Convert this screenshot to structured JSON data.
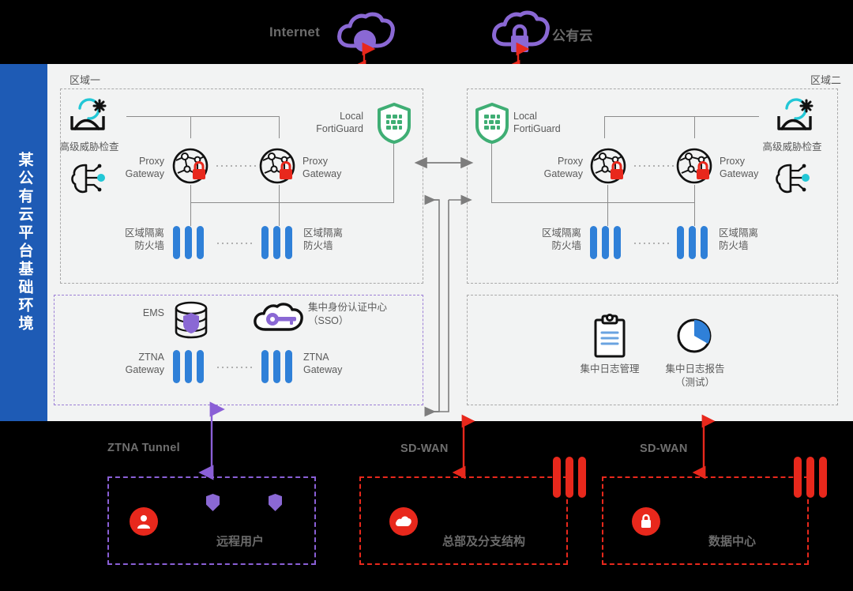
{
  "clouds": [
    {
      "id": "internet",
      "label": "Internet",
      "icon": "cloud-node-icon"
    },
    {
      "id": "public-cloud",
      "label": "公有云",
      "icon": "cloud-lock-icon"
    }
  ],
  "sidebar": {
    "title": "某公有云平台基础环境",
    "color": "#1e5bb5"
  },
  "zones": [
    {
      "id": "zone-one",
      "title": "区域一",
      "threat_inspection": {
        "label": "高级威胁检查",
        "icon": "threat-sandbox-icon"
      },
      "ai_icon": "ai-brain-icon",
      "fortiguard": {
        "label": "Local\nFortiGuard",
        "icon": "shield-grid-icon",
        "color": "#3fae74"
      },
      "proxy_gateways": [
        {
          "label": "Proxy\nGateway",
          "icon": "globe-lock-icon"
        },
        {
          "label": "Proxy\nGateway",
          "icon": "globe-lock-icon"
        }
      ],
      "firewalls": [
        {
          "label": "区域隔离\n防火墙",
          "icon": "firewall-bars-icon"
        },
        {
          "label": "区域隔离\n防火墙",
          "icon": "firewall-bars-icon"
        }
      ]
    },
    {
      "id": "zone-two",
      "title": "区域二",
      "threat_inspection": {
        "label": "高级威胁检查",
        "icon": "threat-sandbox-icon"
      },
      "ai_icon": "ai-brain-icon",
      "fortiguard": {
        "label": "Local\nFortiGuard",
        "icon": "shield-grid-icon",
        "color": "#3fae74"
      },
      "proxy_gateways": [
        {
          "label": "Proxy\nGateway",
          "icon": "globe-lock-icon"
        },
        {
          "label": "Proxy\nGateway",
          "icon": "globe-lock-icon"
        }
      ],
      "firewalls": [
        {
          "label": "区域隔离\n防火墙",
          "icon": "firewall-bars-icon"
        },
        {
          "label": "区域隔离\n防火墙",
          "icon": "firewall-bars-icon"
        }
      ]
    }
  ],
  "services_left": {
    "id": "identity-zone",
    "border_color": "#9c7fd6",
    "ems": {
      "label": "EMS",
      "icon": "database-shield-icon"
    },
    "sso": {
      "label": "集中身份认证中心\n（SSO）",
      "icon": "cloud-key-icon"
    },
    "ztna_gateways": [
      {
        "label": "ZTNA\nGateway",
        "icon": "firewall-bars-icon"
      },
      {
        "label": "ZTNA\nGateway",
        "icon": "firewall-bars-icon"
      }
    ]
  },
  "services_right": {
    "id": "logging-zone",
    "items": [
      {
        "label": "集中日志管理",
        "icon": "clipboard-log-icon"
      },
      {
        "label": "集中日志报告\n（测试）",
        "icon": "pie-chart-icon"
      }
    ]
  },
  "bottom": {
    "links": [
      {
        "label": "ZTNA Tunnel",
        "color": "#8a5fd6"
      },
      {
        "label": "SD-WAN",
        "color": "#e8281c"
      },
      {
        "label": "SD-WAN",
        "color": "#e8281c"
      }
    ],
    "sites": [
      {
        "id": "remote-users",
        "name": "远程用户",
        "color": "#8a5fd6",
        "icon": "user-circle-icon",
        "badges": [
          "shield-badge",
          "shield-badge"
        ],
        "edge_device": null
      },
      {
        "id": "hq-branches",
        "name": "总部及分支结构",
        "color": "#e8281c",
        "icon": "cloud-circle-icon",
        "badges": [],
        "edge_device": "firewall-bars-icon"
      },
      {
        "id": "data-center",
        "name": "数据中心",
        "color": "#e8281c",
        "icon": "lock-circle-icon",
        "badges": [],
        "edge_device": "firewall-bars-icon"
      }
    ]
  },
  "colors": {
    "background": "#000000",
    "platform": "#f2f3f3",
    "sidebar": "#1e5bb5",
    "firewall_blue": "#2f80d8",
    "red": "#e8281c",
    "purple": "#8a5fd6",
    "green": "#3fae74",
    "cyan": "#22c7d6",
    "connector_gray": "#8c8c8c"
  }
}
